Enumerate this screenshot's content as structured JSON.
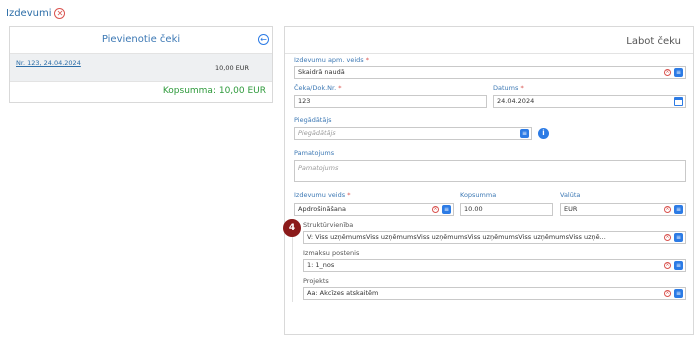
{
  "page": {
    "title": "Izdevumi"
  },
  "left": {
    "title": "Pievienotie čeki",
    "receipt": {
      "link": "Nr. 123, 24.04.2024",
      "amount": "10,00 EUR"
    },
    "total": "Kopsumma: 10,00 EUR"
  },
  "right": {
    "title": "Labot čeku",
    "payment_method": {
      "label": "Izdevumu apm. veids",
      "value": "Skaidrā naudā"
    },
    "receipt_no": {
      "label": "Čeka/Dok.Nr.",
      "value": "123"
    },
    "date": {
      "label": "Datums",
      "value": "24.04.2024"
    },
    "supplier": {
      "label": "Piegādātājs",
      "placeholder": "Piegādātājs"
    },
    "justification": {
      "label": "Pamatojums",
      "placeholder": "Pamatojums"
    },
    "expense_type": {
      "label": "Izdevumu veids",
      "value": "Apdrošināšana"
    },
    "amount": {
      "label": "Kopsumma",
      "value": "10.00"
    },
    "currency": {
      "label": "Valūta",
      "value": "EUR"
    },
    "structural_unit": {
      "label": "Struktūrvienība",
      "value": "V: Viss uzņēmumsViss uzņēmumsViss uzņēmumsViss uzņēmumsViss uzņēmumsViss uzņē..."
    },
    "cost_center": {
      "label": "Izmaksu postenis",
      "value": "1: 1_nos"
    },
    "project": {
      "label": "Projekts",
      "value": "Aa: Akcīzes atskaitēm"
    },
    "badge": "4"
  },
  "colors": {
    "accent": "#2c7be5",
    "total": "#2e9a3b",
    "required": "#d9534f",
    "badge": "#8b1a1a"
  }
}
